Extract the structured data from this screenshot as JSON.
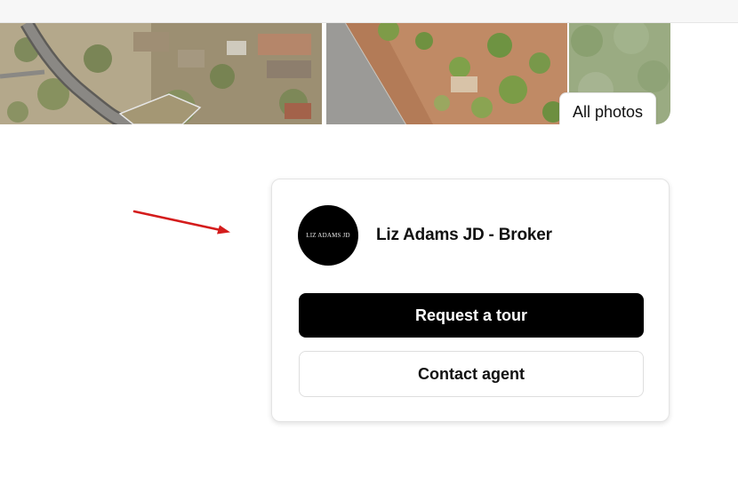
{
  "gallery": {
    "all_photos_label": "All photos",
    "photos": [
      "aerial-neighborhood-photo",
      "aerial-road-lot-photo",
      "brush-vegetation-photo"
    ]
  },
  "annotation": {
    "color": "#d41c1c"
  },
  "agent_card": {
    "avatar_text": "LIZ ADAMS JD",
    "name": "Liz Adams JD - Broker",
    "request_tour_label": "Request a tour",
    "contact_agent_label": "Contact agent"
  }
}
